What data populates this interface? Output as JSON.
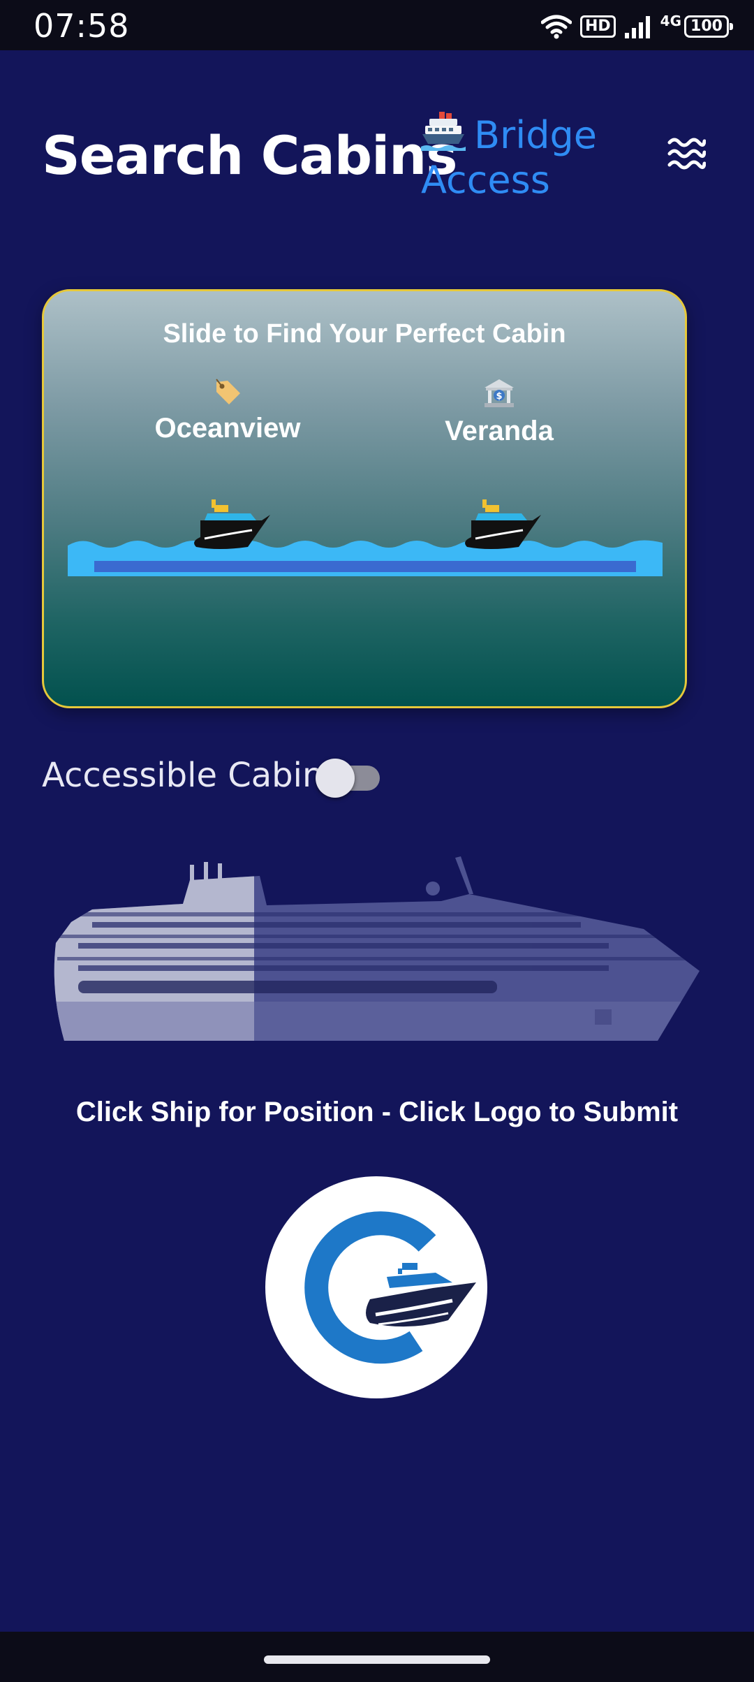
{
  "status_bar": {
    "time": "07:58",
    "hd": "HD",
    "network": "4G",
    "battery": "100"
  },
  "header": {
    "title": "Search Cabins",
    "bridge_link": "Bridge Access",
    "bridge_icon": "ship-icon",
    "menu_icon": "waves-icon"
  },
  "cabin_slider": {
    "title": "Slide to Find Your Perfect Cabin",
    "options": [
      {
        "label": "Oceanview",
        "icon": "price-tag-icon"
      },
      {
        "label": "Veranda",
        "icon": "bank-icon"
      }
    ]
  },
  "accessible": {
    "label": "Accessible Cabin",
    "enabled": false
  },
  "instructions": "Click Ship for Position - Click Logo to Submit",
  "colors": {
    "background": "#13155a",
    "accent_link": "#2f8cf4",
    "card_border": "#e6c83a",
    "water": "#3cb8f6"
  }
}
